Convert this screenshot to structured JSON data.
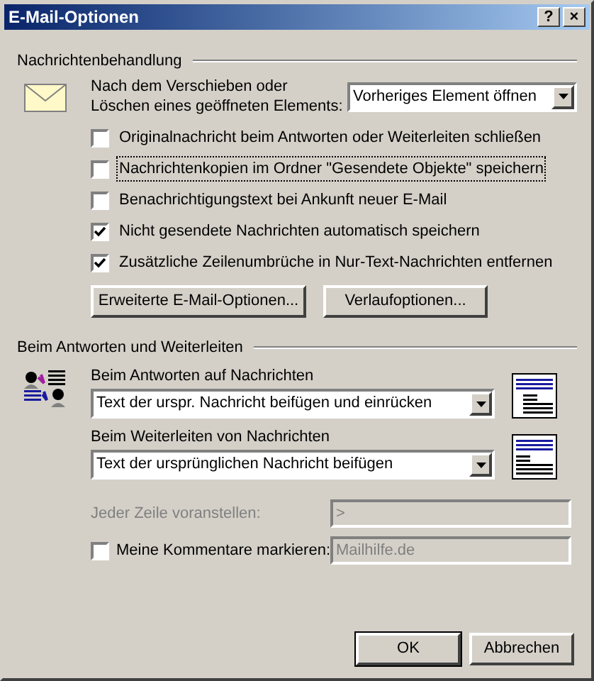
{
  "window": {
    "title": "E-Mail-Optionen",
    "buttons": [
      "?",
      "×"
    ]
  },
  "message_handling": {
    "title": "Nachrichtenbehandlung",
    "after_move_label": "Nach dem Verschieben oder\nLöschen eines geöffneten Elements:",
    "after_move_value": "Vorheriges Element öffnen",
    "checkboxes": [
      {
        "label": "Originalnachricht beim Antworten oder Weiterleiten schließen",
        "checked": false,
        "focused": false
      },
      {
        "label": "Nachrichtenkopien im Ordner \"Gesendete Objekte\" speichern",
        "checked": false,
        "focused": true
      },
      {
        "label": "Benachrichtigungstext bei Ankunft neuer E-Mail",
        "checked": false,
        "focused": false
      },
      {
        "label": "Nicht gesendete Nachrichten automatisch speichern",
        "checked": true,
        "focused": false
      },
      {
        "label": "Zusätzliche Zeilenumbrüche in Nur-Text-Nachrichten entfernen",
        "checked": true,
        "focused": false
      }
    ],
    "buttons": [
      "Erweiterte E-Mail-Optionen...",
      "Verlaufoptionen..."
    ]
  },
  "reply_forward": {
    "title": "Beim Antworten und Weiterleiten",
    "reply": {
      "label": "Beim Antworten auf Nachrichten",
      "value": "Text der urspr. Nachricht beifügen und einrücken"
    },
    "forward": {
      "label": "Beim Weiterleiten von Nachrichten",
      "value": "Text der ursprünglichen Nachricht beifügen"
    },
    "prefix": {
      "label": "Jeder Zeile voranstellen:",
      "value": ">",
      "disabled": true
    },
    "mark_comments": {
      "label": "Meine Kommentare markieren:",
      "checked": false,
      "value": "Mailhilfe.de",
      "disabled": true
    }
  },
  "footer_buttons": [
    {
      "label": "OK",
      "default": true
    },
    {
      "label": "Abbrechen",
      "default": false
    }
  ]
}
